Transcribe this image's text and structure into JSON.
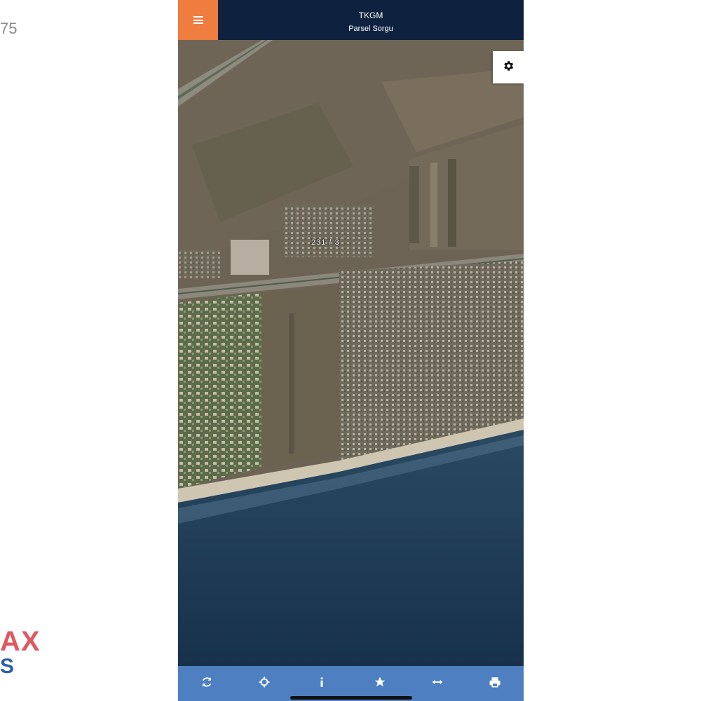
{
  "side": {
    "number_fragment": "75",
    "logo_line1": "AX",
    "logo_line2": "S"
  },
  "header": {
    "menu_icon": "hamburger-menu-icon",
    "title": "TKGM",
    "subtitle": "Parsel Sorgu"
  },
  "map": {
    "settings_icon": "gear-icon",
    "parcel_label": "231 / 3"
  },
  "toolbar": {
    "buttons": [
      {
        "name": "refresh",
        "icon": "refresh-icon"
      },
      {
        "name": "locate",
        "icon": "location-target-icon"
      },
      {
        "name": "info",
        "icon": "info-icon"
      },
      {
        "name": "favorite",
        "icon": "star-icon"
      },
      {
        "name": "measure",
        "icon": "measure-icon"
      },
      {
        "name": "print",
        "icon": "print-icon"
      }
    ]
  },
  "colors": {
    "header_bg": "#0e2240",
    "menu_bg": "#ef7d3f",
    "toolbar_bg": "#4d7fc1",
    "sea": "#1f3a55",
    "land": "#6e6456"
  }
}
